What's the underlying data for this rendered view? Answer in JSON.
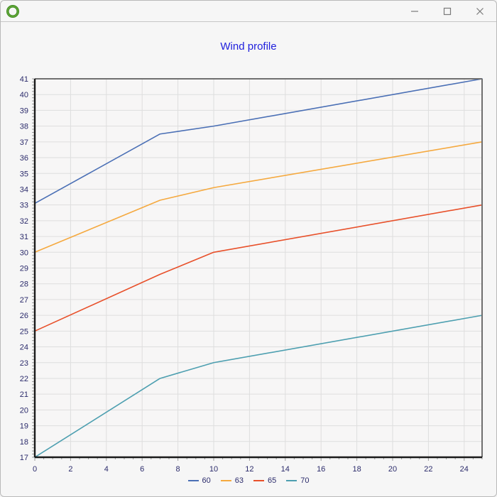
{
  "window": {
    "title": "",
    "icon": "green-ring-icon",
    "controls": {
      "minimize_label": "Minimize",
      "maximize_label": "Maximize",
      "close_label": "Close"
    }
  },
  "chart_data": {
    "type": "line",
    "title": "Wind profile",
    "title_color": "#2020dd",
    "xlabel": "",
    "ylabel": "",
    "xlim": [
      0,
      25
    ],
    "ylim": [
      17,
      41
    ],
    "xticks": [
      0,
      2,
      4,
      6,
      8,
      10,
      12,
      14,
      16,
      18,
      20,
      22,
      24
    ],
    "yticks": [
      17,
      18,
      19,
      20,
      21,
      22,
      23,
      24,
      25,
      26,
      27,
      28,
      29,
      30,
      31,
      32,
      33,
      34,
      35,
      36,
      37,
      38,
      39,
      40,
      41
    ],
    "grid": true,
    "legend_position": "bottom",
    "series": [
      {
        "name": "60",
        "color": "#4a6fb5",
        "x": [
          0,
          7,
          10,
          25
        ],
        "values": [
          33.1,
          37.5,
          38.0,
          41.0
        ]
      },
      {
        "name": "63",
        "color": "#f5a93f",
        "x": [
          0,
          7,
          10,
          25
        ],
        "values": [
          30.0,
          33.3,
          34.1,
          37.0
        ]
      },
      {
        "name": "65",
        "color": "#e8502a",
        "x": [
          0,
          7,
          10,
          25
        ],
        "values": [
          25.0,
          28.6,
          30.0,
          33.0
        ]
      },
      {
        "name": "70",
        "color": "#4d9fb0",
        "x": [
          0,
          7,
          10,
          25
        ],
        "values": [
          17.0,
          22.0,
          23.0,
          26.0
        ]
      }
    ]
  }
}
